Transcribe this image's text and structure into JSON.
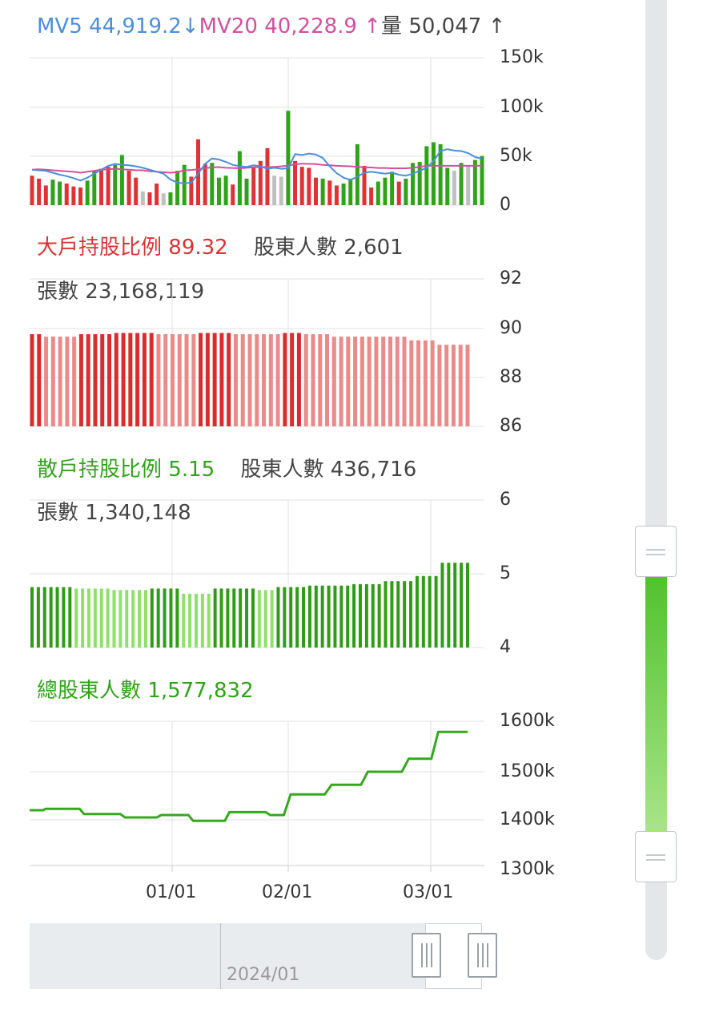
{
  "volume_header": {
    "mv5_label": "MV5",
    "mv5_value": "44,919.2",
    "mv5_arrow": "↓",
    "mv20_label": "MV20",
    "mv20_value": "40,228.9",
    "mv20_arrow": "↑",
    "vol_label": "量",
    "vol_value": "50,047",
    "vol_arrow": "↑"
  },
  "big_header": {
    "title": "大戶持股比例",
    "value": "89.32",
    "holders_label": "股東人數",
    "holders_value": "2,601",
    "shares_label": "張數",
    "shares_value": "23,168,119"
  },
  "retail_header": {
    "title": "散戶持股比例",
    "value": "5.15",
    "holders_label": "股東人數",
    "holders_value": "436,716",
    "shares_label": "張數",
    "shares_value": "1,340,148"
  },
  "total_header": {
    "title": "總股東人數",
    "value": "1,577,832"
  },
  "navigator": {
    "label": "2024/01"
  },
  "colors": {
    "up": "#2fa318",
    "down": "#dd3333",
    "flat": "#c0c0c0",
    "mv5": "#4a8fd9",
    "mv20": "#d44f9e",
    "big_dark": "#d92d2d",
    "big_light": "#ec8a8a",
    "retail_dark": "#2f9c16",
    "retail_light": "#8fe068",
    "total_line": "#35a81f",
    "grid": "#e2e2e2"
  },
  "chart_data": [
    {
      "type": "bar",
      "name": "volume",
      "x_ticks": [
        "01/01",
        "02/01",
        "03/01"
      ],
      "y_ticks": [
        "150k",
        "100k",
        "50k",
        "0"
      ],
      "ylim": [
        0,
        150000
      ],
      "volumes": [
        30000,
        27000,
        20000,
        26000,
        24000,
        22000,
        19000,
        18000,
        25000,
        35000,
        37000,
        39000,
        41000,
        51000,
        35000,
        28000,
        14000,
        13000,
        22000,
        12000,
        13000,
        35000,
        41000,
        29000,
        67000,
        42000,
        43000,
        28000,
        30000,
        21000,
        55000,
        27000,
        38000,
        45000,
        58000,
        30000,
        29000,
        96000,
        45000,
        39000,
        38000,
        28000,
        27000,
        25000,
        20000,
        22000,
        27000,
        62000,
        40000,
        18000,
        24000,
        28000,
        34000,
        24000,
        27000,
        43000,
        44000,
        60000,
        64000,
        62000,
        38000,
        35000,
        43000,
        40000,
        46000,
        50000
      ],
      "directions": [
        "d",
        "d",
        "d",
        "u",
        "u",
        "d",
        "d",
        "d",
        "u",
        "u",
        "d",
        "d",
        "u",
        "u",
        "d",
        "d",
        "f",
        "d",
        "d",
        "f",
        "u",
        "u",
        "u",
        "d",
        "d",
        "d",
        "u",
        "u",
        "u",
        "d",
        "u",
        "u",
        "d",
        "d",
        "d",
        "f",
        "f",
        "u",
        "d",
        "d",
        "d",
        "d",
        "u",
        "d",
        "d",
        "u",
        "u",
        "u",
        "d",
        "d",
        "u",
        "u",
        "u",
        "d",
        "u",
        "u",
        "u",
        "u",
        "u",
        "u",
        "u",
        "f",
        "u",
        "f",
        "u",
        "u"
      ],
      "mv5": [
        36000,
        35500,
        35000,
        33000,
        31000,
        29500,
        27500,
        25000,
        28000,
        32000,
        36000,
        40000,
        42000,
        41000,
        40500,
        39500,
        38000,
        36000,
        34000,
        32000,
        26000,
        23000,
        22000,
        23000,
        32000,
        42000,
        47500,
        46500,
        44000,
        41000,
        39500,
        39000,
        40500,
        39500,
        37000,
        38000,
        37000,
        37500,
        52000,
        51000,
        52500,
        51500,
        48000,
        39500,
        32500,
        28000,
        25500,
        29000,
        33000,
        34000,
        33000,
        32000,
        33000,
        31000,
        30000,
        32000,
        35000,
        38000,
        45000,
        55000,
        57000,
        55500,
        55000,
        53000,
        49000,
        47000
      ],
      "mv20": [
        36000,
        36500,
        36000,
        35500,
        35000,
        34500,
        34000,
        33000,
        34000,
        35000,
        36000,
        36500,
        37000,
        36500,
        36000,
        35500,
        35500,
        34500,
        34000,
        33500,
        33000,
        33500,
        35500,
        35800,
        36500,
        37500,
        38500,
        38700,
        38000,
        37800,
        37500,
        38000,
        38500,
        38700,
        38800,
        39000,
        39500,
        40300,
        41500,
        42200,
        42000,
        41800,
        41000,
        40500,
        40000,
        39800,
        39500,
        39000,
        38500,
        38300,
        37800,
        37800,
        37500,
        37500,
        37500,
        38000,
        39000,
        40000,
        40000,
        40000,
        40000,
        40000,
        40000,
        40000,
        40000,
        40000
      ]
    },
    {
      "type": "bar",
      "name": "large_holders_pct",
      "y_ticks": [
        "92",
        "90",
        "88",
        "86"
      ],
      "ylim": [
        86,
        92
      ],
      "values": [
        89.75,
        89.75,
        89.65,
        89.65,
        89.65,
        89.65,
        89.65,
        89.75,
        89.75,
        89.75,
        89.75,
        89.75,
        89.8,
        89.8,
        89.8,
        89.8,
        89.8,
        89.8,
        89.75,
        89.75,
        89.75,
        89.75,
        89.75,
        89.75,
        89.8,
        89.8,
        89.8,
        89.8,
        89.8,
        89.75,
        89.75,
        89.75,
        89.75,
        89.75,
        89.75,
        89.75,
        89.8,
        89.8,
        89.8,
        89.75,
        89.75,
        89.75,
        89.75,
        89.65,
        89.65,
        89.65,
        89.65,
        89.65,
        89.65,
        89.65,
        89.65,
        89.65,
        89.65,
        89.65,
        89.5,
        89.5,
        89.5,
        89.5,
        89.32,
        89.32,
        89.32,
        89.32,
        89.32
      ],
      "shades": [
        "d",
        "d",
        "l",
        "l",
        "l",
        "l",
        "l",
        "d",
        "d",
        "d",
        "d",
        "d",
        "d",
        "d",
        "d",
        "d",
        "d",
        "d",
        "l",
        "l",
        "l",
        "l",
        "l",
        "l",
        "d",
        "d",
        "d",
        "d",
        "d",
        "l",
        "l",
        "l",
        "l",
        "l",
        "l",
        "l",
        "d",
        "d",
        "d",
        "l",
        "l",
        "l",
        "l",
        "l",
        "l",
        "l",
        "l",
        "l",
        "l",
        "l",
        "l",
        "l",
        "l",
        "l",
        "l",
        "l",
        "l",
        "l",
        "l",
        "l",
        "l",
        "l",
        "l"
      ]
    },
    {
      "type": "bar",
      "name": "retail_holders_pct",
      "y_ticks": [
        "6",
        "5",
        "4"
      ],
      "ylim": [
        4,
        6
      ],
      "values": [
        4.82,
        4.82,
        4.82,
        4.82,
        4.82,
        4.82,
        4.82,
        4.8,
        4.8,
        4.8,
        4.8,
        4.8,
        4.8,
        4.78,
        4.78,
        4.78,
        4.78,
        4.78,
        4.78,
        4.8,
        4.8,
        4.8,
        4.8,
        4.8,
        4.73,
        4.73,
        4.73,
        4.73,
        4.73,
        4.8,
        4.8,
        4.8,
        4.8,
        4.8,
        4.8,
        4.8,
        4.78,
        4.78,
        4.78,
        4.82,
        4.82,
        4.82,
        4.82,
        4.82,
        4.84,
        4.84,
        4.84,
        4.84,
        4.84,
        4.84,
        4.84,
        4.86,
        4.86,
        4.86,
        4.86,
        4.86,
        4.9,
        4.9,
        4.9,
        4.9,
        4.9,
        4.97,
        4.97,
        4.97,
        4.97,
        5.15,
        5.15,
        5.15,
        5.15,
        5.15
      ],
      "shades": [
        "d",
        "d",
        "d",
        "d",
        "d",
        "d",
        "d",
        "l",
        "l",
        "l",
        "l",
        "l",
        "l",
        "l",
        "l",
        "l",
        "l",
        "l",
        "l",
        "d",
        "d",
        "d",
        "d",
        "d",
        "l",
        "l",
        "l",
        "l",
        "l",
        "d",
        "d",
        "d",
        "d",
        "d",
        "d",
        "d",
        "l",
        "l",
        "l",
        "d",
        "d",
        "d",
        "d",
        "d",
        "d",
        "d",
        "d",
        "d",
        "d",
        "d",
        "d",
        "d",
        "d",
        "d",
        "d",
        "d",
        "d",
        "d",
        "d",
        "d",
        "d",
        "d",
        "d",
        "d",
        "d",
        "d",
        "d",
        "d",
        "d",
        "d"
      ]
    },
    {
      "type": "line",
      "name": "total_holders",
      "x_ticks": [
        "01/01",
        "02/01",
        "03/01"
      ],
      "y_ticks": [
        "1600k",
        "1500k",
        "1400k",
        "1300k"
      ],
      "ylim": [
        1300000,
        1600000
      ],
      "points": [
        [
          0,
          1415000
        ],
        [
          0.03,
          1415000
        ],
        [
          0.035,
          1418000
        ],
        [
          0.11,
          1418000
        ],
        [
          0.12,
          1407000
        ],
        [
          0.2,
          1407000
        ],
        [
          0.21,
          1400000
        ],
        [
          0.28,
          1400000
        ],
        [
          0.29,
          1405000
        ],
        [
          0.35,
          1405000
        ],
        [
          0.36,
          1393000
        ],
        [
          0.43,
          1393000
        ],
        [
          0.44,
          1411000
        ],
        [
          0.52,
          1411000
        ],
        [
          0.53,
          1405000
        ],
        [
          0.56,
          1405000
        ],
        [
          0.575,
          1448000
        ],
        [
          0.65,
          1448000
        ],
        [
          0.665,
          1468000
        ],
        [
          0.73,
          1468000
        ],
        [
          0.745,
          1495000
        ],
        [
          0.82,
          1495000
        ],
        [
          0.835,
          1522000
        ],
        [
          0.885,
          1522000
        ],
        [
          0.9,
          1577832
        ],
        [
          0.965,
          1577832
        ]
      ]
    }
  ]
}
